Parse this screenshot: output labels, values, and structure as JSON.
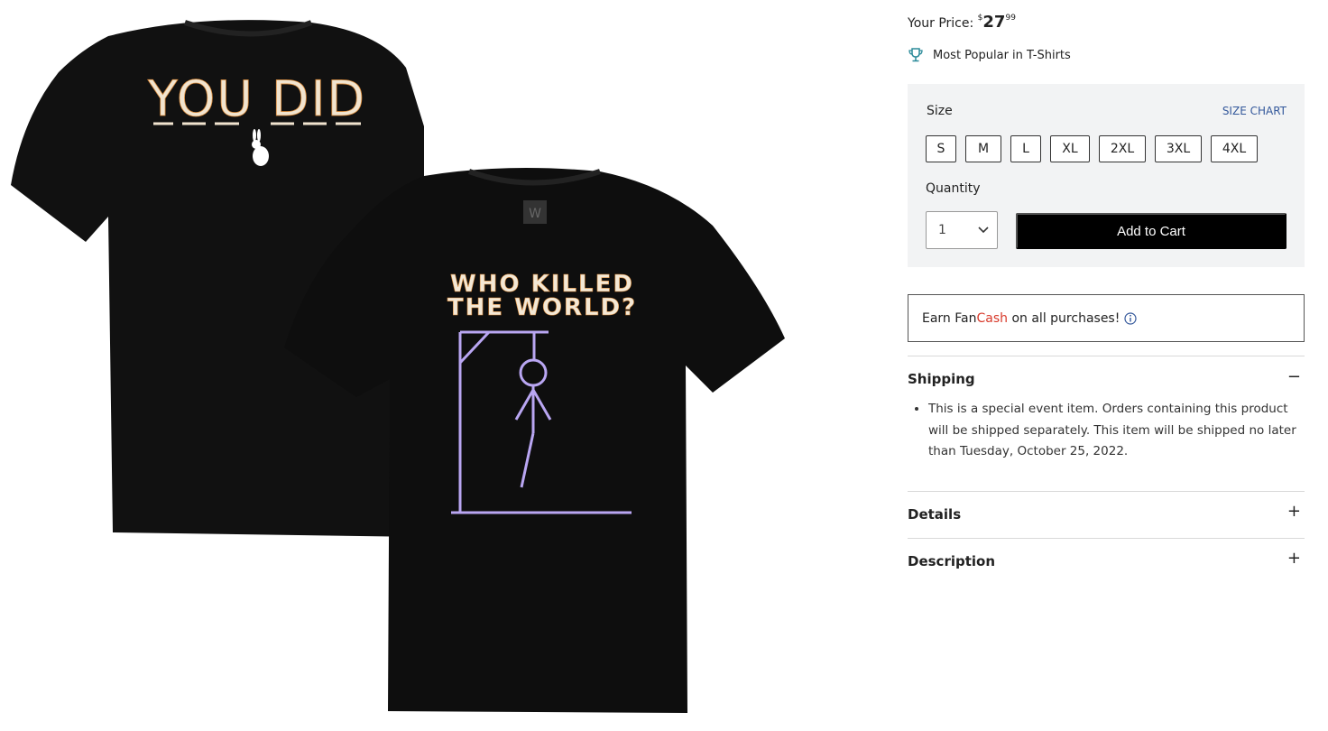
{
  "price": {
    "label": "Your Price:",
    "currency": "$",
    "dollars": "27",
    "cents": "99"
  },
  "popular": {
    "icon": "trophy-icon",
    "text": "Most Popular in T-Shirts"
  },
  "size": {
    "label": "Size",
    "chart_link": "SIZE CHART",
    "options": [
      "S",
      "M",
      "L",
      "XL",
      "2XL",
      "3XL",
      "4XL"
    ]
  },
  "quantity": {
    "label": "Quantity",
    "value": "1"
  },
  "cart": {
    "button_label": "Add to Cart"
  },
  "fancash": {
    "prefix": "Earn Fan",
    "highlight": "Cash",
    "suffix": " on all purchases!",
    "highlight_color": "#d83a2b"
  },
  "accordion": {
    "shipping": {
      "title": "Shipping",
      "sign": "−",
      "text": "This is a special event item. Orders containing this product will be shipped separately. This item will be shipped no later than Tuesday, October 25, 2022."
    },
    "details": {
      "title": "Details",
      "sign": "+"
    },
    "description": {
      "title": "Description",
      "sign": "+"
    }
  },
  "product_art": {
    "back_text": "YOU DID",
    "front_text_line1": "WHO KILLED",
    "front_text_line2": "THE WORLD?"
  },
  "colors": {
    "accent_link": "#34589b",
    "panel_bg": "#f2f3f4",
    "button_bg": "#000000"
  }
}
